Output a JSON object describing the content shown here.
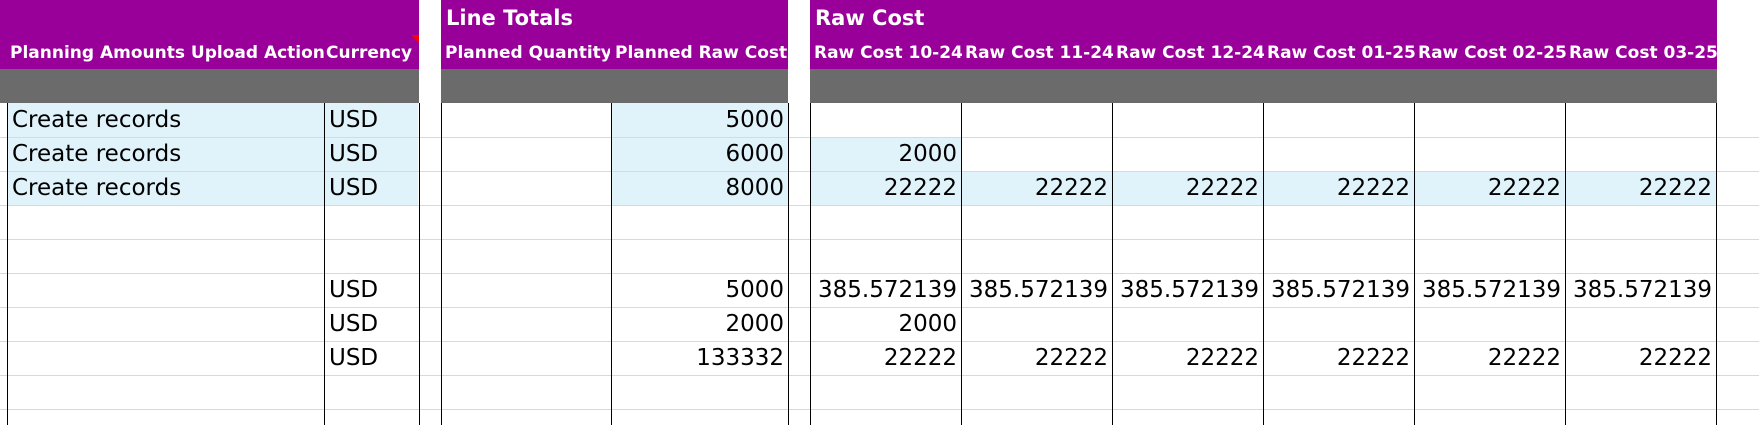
{
  "group_headers": {
    "line_totals": "Line Totals",
    "raw_cost": "Raw Cost"
  },
  "columns": {
    "action": "Planning Amounts Upload Action",
    "currency": "Currency",
    "planned_quantity": "Planned Quantity",
    "planned_raw_cost": "Planned Raw Cost",
    "periods": [
      "Raw Cost 10-24",
      "Raw Cost 11-24",
      "Raw Cost 12-24",
      "Raw Cost 01-25",
      "Raw Cost 02-25",
      "Raw Cost 03-25"
    ]
  },
  "rows": [
    {
      "action": "Create records",
      "currency": "USD",
      "planned_quantity": "",
      "planned_raw_cost": "5000",
      "periods": [
        "",
        "",
        "",
        "",
        "",
        ""
      ]
    },
    {
      "action": "Create records",
      "currency": "USD",
      "planned_quantity": "",
      "planned_raw_cost": "6000",
      "periods": [
        "2000",
        "",
        "",
        "",
        "",
        ""
      ]
    },
    {
      "action": "Create records",
      "currency": "USD",
      "planned_quantity": "",
      "planned_raw_cost": "8000",
      "periods": [
        "22222",
        "22222",
        "22222",
        "22222",
        "22222",
        "22222"
      ]
    },
    {
      "action": "",
      "currency": "",
      "planned_quantity": "",
      "planned_raw_cost": "",
      "periods": [
        "",
        "",
        "",
        "",
        "",
        ""
      ]
    },
    {
      "action": "",
      "currency": "",
      "planned_quantity": "",
      "planned_raw_cost": "",
      "periods": [
        "",
        "",
        "",
        "",
        "",
        ""
      ]
    },
    {
      "action": "",
      "currency": "USD",
      "planned_quantity": "",
      "planned_raw_cost": "5000",
      "periods": [
        "385.572139",
        "385.572139",
        "385.572139",
        "385.572139",
        "385.572139",
        "385.572139"
      ]
    },
    {
      "action": "",
      "currency": "USD",
      "planned_quantity": "",
      "planned_raw_cost": "2000",
      "periods": [
        "2000",
        "",
        "",
        "",
        "",
        ""
      ]
    },
    {
      "action": "",
      "currency": "USD",
      "planned_quantity": "",
      "planned_raw_cost": "133332",
      "periods": [
        "22222",
        "22222",
        "22222",
        "22222",
        "22222",
        "22222"
      ]
    },
    {
      "action": "",
      "currency": "",
      "planned_quantity": "",
      "planned_raw_cost": "",
      "periods": [
        "",
        "",
        "",
        "",
        "",
        ""
      ]
    },
    {
      "action": "",
      "currency": "",
      "planned_quantity": "",
      "planned_raw_cost": "",
      "periods": [
        "",
        "",
        "",
        "",
        "",
        ""
      ]
    }
  ],
  "colors": {
    "header_band": "#990099",
    "subheader_band": "#6b6b6b",
    "highlight_fill": "#e0f3fb"
  }
}
